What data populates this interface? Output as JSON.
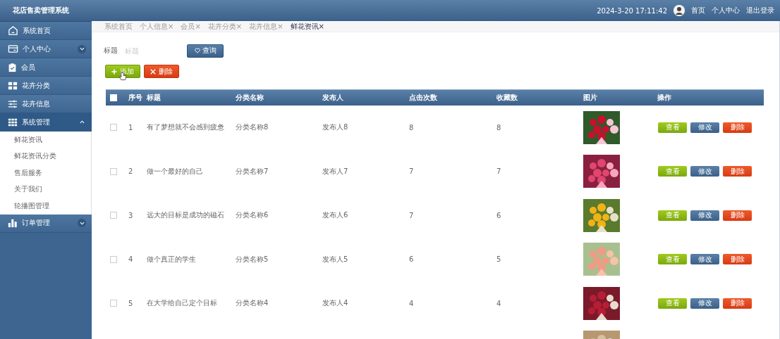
{
  "header": {
    "title": "花店售卖管理系统",
    "datetime": "2024-3-20 17:11:42",
    "links": [
      "首页",
      "个人中心",
      "退出登录"
    ]
  },
  "sidebar": {
    "items": [
      {
        "kind": "link",
        "label": "系统首页"
      },
      {
        "kind": "group",
        "label": "个人中心",
        "expanded": false
      },
      {
        "kind": "link",
        "label": "会员"
      },
      {
        "kind": "link",
        "label": "花卉分类"
      },
      {
        "kind": "link",
        "label": "花卉信息"
      },
      {
        "kind": "group",
        "label": "系统管理",
        "expanded": true,
        "children": [
          "鲜花资讯",
          "鲜花资讯分类",
          "售后服务",
          "关于我们",
          "轮播图管理"
        ]
      },
      {
        "kind": "group",
        "label": "订单管理",
        "expanded": false
      }
    ]
  },
  "tabs": [
    {
      "label": "系统首页",
      "selected": false
    },
    {
      "label": "个人信息×",
      "selected": false
    },
    {
      "label": "会员×",
      "selected": false
    },
    {
      "label": "花卉分类×",
      "selected": false
    },
    {
      "label": "花卉信息×",
      "selected": false
    },
    {
      "label": "鲜花资讯×",
      "selected": true
    }
  ],
  "search": {
    "label": "标题",
    "placeholder": "标题",
    "button": "查询"
  },
  "actions": [
    {
      "kind": "add",
      "label": "添加"
    },
    {
      "kind": "delete",
      "label": "删除"
    }
  ],
  "table": {
    "all_checked": false,
    "columns": [
      "序号",
      "标题",
      "分类名称",
      "发布人",
      "点击次数",
      "收藏数",
      "图片",
      "操作"
    ],
    "rows": [
      {
        "checked": false,
        "cells": [
          "1",
          "有了梦想就不会感到疲惫",
          "分类名称8",
          "发布人8",
          "8",
          "8"
        ],
        "image": {
          "kind": "picture"
        },
        "actions": [
          "查看",
          "修改",
          "删除"
        ]
      },
      {
        "checked": false,
        "cells": [
          "2",
          "做一个最好的自己",
          "分类名称7",
          "发布人7",
          "7",
          "7"
        ],
        "image": {
          "kind": "picture"
        },
        "actions": [
          "查看",
          "修改",
          "删除"
        ]
      },
      {
        "checked": false,
        "cells": [
          "3",
          "远大的目标是成功的磁石",
          "分类名称6",
          "发布人6",
          "7",
          "6"
        ],
        "image": {
          "kind": "picture"
        },
        "actions": [
          "查看",
          "修改",
          "删除"
        ]
      },
      {
        "checked": false,
        "cells": [
          "4",
          "做个真正的学生",
          "分类名称5",
          "发布人5",
          "6",
          "5"
        ],
        "image": {
          "kind": "picture"
        },
        "actions": [
          "查看",
          "修改",
          "删除"
        ]
      },
      {
        "checked": false,
        "cells": [
          "5",
          "在大学给自己定个目标",
          "分类名称4",
          "发布人4",
          "4",
          "4"
        ],
        "image": {
          "kind": "picture"
        },
        "actions": [
          "查看",
          "修改",
          "删除"
        ]
      },
      {
        "image": {
          "kind": "picture"
        }
      }
    ]
  }
}
